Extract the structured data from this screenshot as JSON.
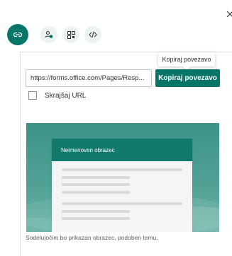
{
  "share_tabs": [
    {
      "id": "link",
      "icon": "link-icon",
      "active": true
    },
    {
      "id": "qr",
      "icon": "qr-code-icon",
      "active": false
    },
    {
      "id": "email",
      "icon": "mail-icon",
      "active": false
    },
    {
      "id": "embed",
      "icon": "embed-code-icon",
      "active": false
    }
  ],
  "tooltip": "Kopiraj povezavo",
  "url_value": "https://forms.office.com/Pages/Resp...",
  "copy_button_label": "Kopiraj povezavo",
  "shorten_label": "Skrajšaj URL",
  "preview": {
    "form_title": "Neimenovan obrazec"
  },
  "caption": "Sodelujočim bo prikazan obrazec, podoben temu.",
  "colors": {
    "accent": "#077568",
    "tab_bg": "#ecf4f3",
    "preview_bg": "#4a9d91",
    "card_header": "#127a6c"
  }
}
